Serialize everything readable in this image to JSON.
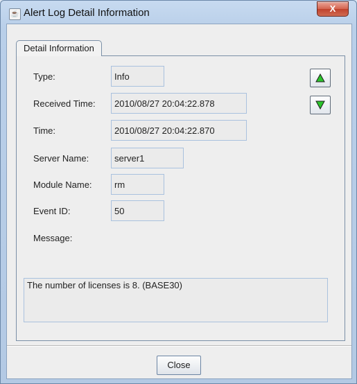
{
  "window": {
    "title": "Alert Log Detail Information",
    "close_glyph": "X"
  },
  "tabs": [
    {
      "label": "Detail Information",
      "selected": true
    }
  ],
  "fields": {
    "type": {
      "label": "Type:",
      "value": "Info"
    },
    "received_time": {
      "label": "Received Time:",
      "value": "2010/08/27 20:04:22.878"
    },
    "time": {
      "label": "Time:",
      "value": "2010/08/27 20:04:22.870"
    },
    "server_name": {
      "label": "Server Name:",
      "value": "server1"
    },
    "module_name": {
      "label": "Module Name:",
      "value": "rm"
    },
    "event_id": {
      "label": "Event ID:",
      "value": "50"
    },
    "message": {
      "label": "Message:",
      "value": "The number of licenses is 8. (BASE30)"
    }
  },
  "navigation": {
    "up_icon": "triangle-up-icon",
    "down_icon": "triangle-down-icon",
    "arrow_color": "#1fae1f"
  },
  "buttons": {
    "close_label": "Close"
  },
  "colors": {
    "titlebar": "#c7daf0",
    "client_background": "#eeeeee",
    "close_button_red": "#c0432d",
    "field_border": "#a9c1de"
  }
}
